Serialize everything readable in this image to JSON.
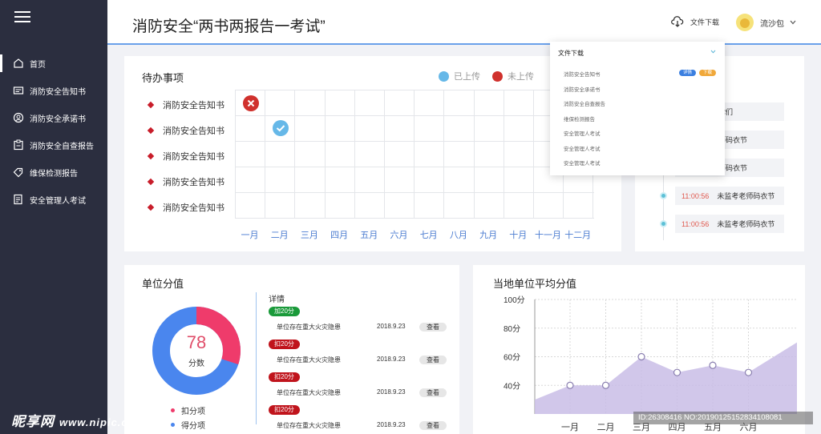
{
  "header": {
    "title": "消防安全“两书两报告一考试”",
    "download_label": "文件下载",
    "user_name": "流沙包"
  },
  "sidebar": {
    "items": [
      {
        "label": "首页",
        "icon": "home-icon"
      },
      {
        "label": "消防安全告知书",
        "icon": "document-icon"
      },
      {
        "label": "消防安全承诺书",
        "icon": "user-icon"
      },
      {
        "label": "消防安全自查报告",
        "icon": "clipboard-icon"
      },
      {
        "label": "维保检测报告",
        "icon": "tag-icon"
      },
      {
        "label": "安全管理人考试",
        "icon": "exam-icon"
      }
    ]
  },
  "todo": {
    "title": "待办事项",
    "legend_uploaded": "已上传",
    "legend_not_uploaded": "未上传",
    "rows": [
      "消防安全告知书",
      "消防安全告知书",
      "消防安全告知书",
      "消防安全告知书",
      "消防安全告知书"
    ],
    "months": [
      "一月",
      "二月",
      "三月",
      "四月",
      "五月",
      "六月",
      "七月",
      "八月",
      "九月",
      "十月",
      "十一月",
      "十二月"
    ],
    "colors": {
      "uploaded": "#66b8e8",
      "not_uploaded": "#d0312d"
    }
  },
  "timeline": {
    "items": [
      {
        "time": "",
        "text": "路口牛后你们"
      },
      {
        "time": "",
        "text": "未监考老师码衣节"
      },
      {
        "time": "",
        "text": "未监考老师码衣节"
      },
      {
        "time": "11:00:56",
        "text": "未监考老师码衣节"
      },
      {
        "time": "11:00:56",
        "text": "未监考老师码衣节"
      }
    ],
    "partial_char": "日"
  },
  "score": {
    "title": "单位分值",
    "value": "78",
    "value_label": "分数",
    "legend_deduct": "扣分项",
    "legend_add": "得分项",
    "ratio_deduct": 0.3,
    "colors": {
      "deduct": "#ef3b6b",
      "add": "#4a86ee"
    },
    "detail_title": "详情",
    "details": [
      {
        "tag": "加20分",
        "tag_type": "add",
        "text": "单位存在重大火灾隐患",
        "date": "2018.9.23",
        "action": "查看"
      },
      {
        "tag": "扣20分",
        "tag_type": "deduct",
        "text": "单位存在重大火灾隐患",
        "date": "2018.9.23",
        "action": "查看"
      },
      {
        "tag": "扣20分",
        "tag_type": "deduct",
        "text": "单位存在重大火灾隐患",
        "date": "2018.9.23",
        "action": "查看"
      },
      {
        "tag": "扣20分",
        "tag_type": "deduct",
        "text": "单位存在重大火灾隐患",
        "date": "2018.9.23",
        "action": "查看"
      }
    ]
  },
  "chart_data": {
    "type": "area",
    "title": "当地单位平均分值",
    "categories": [
      "一月",
      "二月",
      "三月",
      "四月",
      "五月",
      "六月"
    ],
    "values": [
      40,
      40,
      60,
      49,
      54,
      49
    ],
    "yticks": [
      "40分",
      "60分",
      "80分",
      "100分"
    ],
    "ylim": [
      20,
      100
    ],
    "grid": true,
    "color": "#c9bde6"
  },
  "dropdown": {
    "title": "文件下载",
    "items": [
      "消防安全告知书",
      "消防安全承诺书",
      "消防安全自查报告",
      "维保检测报告",
      "安全管理人考试",
      "安全管理人考试",
      "安全管理人考试"
    ],
    "detail_label": "详情",
    "download_label": "下载"
  },
  "watermark": {
    "left": "昵享网",
    "url": "www.nipic.com",
    "right": "ID:26308416 NO:20190125152834108081"
  }
}
